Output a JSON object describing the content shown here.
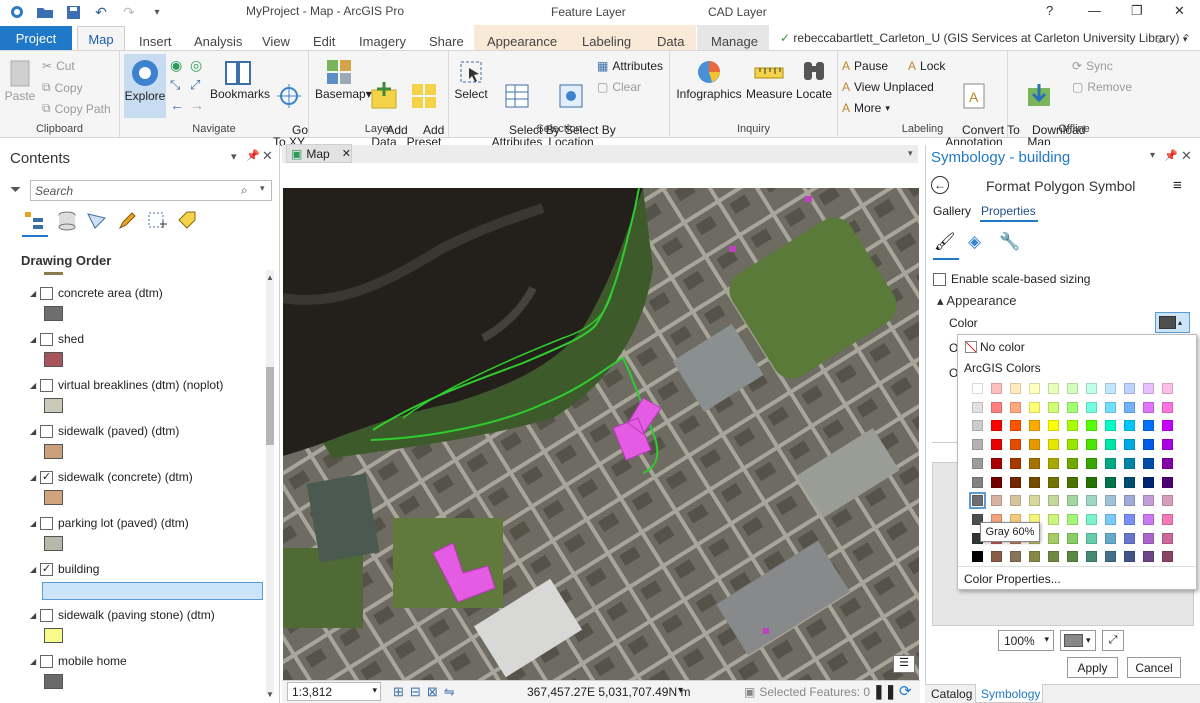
{
  "app": {
    "window_title": "MyProject - Map - ArcGIS Pro",
    "feature_layer": "Feature Layer",
    "cad_layer": "CAD Layer",
    "help": "?"
  },
  "tabs": [
    "Project",
    "Map",
    "Insert",
    "Analysis",
    "View",
    "Edit",
    "Imagery",
    "Share",
    "Appearance",
    "Labeling",
    "Data",
    "Manage"
  ],
  "user": "rebeccabartlett_Carleton_U (GIS Services at Carleton University Library)",
  "ribbon": {
    "clipboard": {
      "label": "Clipboard",
      "paste": "Paste",
      "cut": "Cut",
      "copy": "Copy",
      "copy_path": "Copy Path"
    },
    "navigate": {
      "label": "Navigate",
      "explore": "Explore",
      "bookmarks": "Bookmarks",
      "goto": "Go\nTo XY"
    },
    "layer": {
      "label": "Layer",
      "basemap": "Basemap",
      "add_data": "Add\nData",
      "add_preset": "Add\nPreset"
    },
    "selection": {
      "label": "Selection",
      "select": "Select",
      "by_attr": "Select By\nAttributes",
      "by_loc": "Select By\nLocation",
      "attributes": "Attributes",
      "clear": "Clear"
    },
    "inquiry": {
      "label": "Inquiry",
      "infographics": "Infographics",
      "measure": "Measure",
      "locate": "Locate"
    },
    "labeling": {
      "label": "Labeling",
      "pause": "Pause",
      "lock": "Lock",
      "view_unplaced": "View Unplaced",
      "more": "More",
      "convert": "Convert To\nAnnotation"
    },
    "offline": {
      "label": "Offline",
      "download": "Download\nMap",
      "sync": "Sync",
      "remove": "Remove"
    }
  },
  "contents": {
    "title": "Contents",
    "search_placeholder": "Search",
    "drawing_order": "Drawing Order",
    "layers": [
      {
        "name": "concrete area (dtm)",
        "checked": false,
        "color": "#6e6e6e"
      },
      {
        "name": "shed",
        "checked": false,
        "color": "#a8545c"
      },
      {
        "name": "virtual breaklines (dtm) (noplot)",
        "checked": false,
        "color": "#c9cbb8"
      },
      {
        "name": "sidewalk (paved) (dtm)",
        "checked": false,
        "color": "#c9a07a"
      },
      {
        "name": "sidewalk (concrete) (dtm)",
        "checked": true,
        "color": "#d2a47c"
      },
      {
        "name": "parking lot (paved) (dtm)",
        "checked": false,
        "color": "#b7b8aa"
      },
      {
        "name": "building",
        "checked": true,
        "color": "#e45be4"
      },
      {
        "name": "sidewalk (paving stone) (dtm)",
        "checked": false,
        "color": "#f8fb8a"
      },
      {
        "name": "mobile home",
        "checked": false,
        "color": "#6a6a6a"
      }
    ]
  },
  "map": {
    "tab": "Map",
    "scale": "1:3,812",
    "coords": "367,457.27E 5,031,707.49N m",
    "selected": "Selected Features: 0"
  },
  "symbology": {
    "title": "Symbology - building",
    "subtitle": "Format Polygon Symbol",
    "tab_gallery": "Gallery",
    "tab_properties": "Properties",
    "scale_sizing": "Enable scale-based sizing",
    "appearance": "Appearance",
    "color_label": "Color",
    "o1": "O",
    "o2": "O",
    "no_color": "No color",
    "arcgis_colors": "ArcGIS Colors",
    "tooltip": "Gray 60%",
    "color_props": "Color Properties...",
    "zoom": "100%",
    "apply": "Apply",
    "cancel": "Cancel",
    "bottom_catalog": "Catalog",
    "bottom_symbology": "Symbology"
  },
  "palette": {
    "columns": [
      "#ffffff",
      "#ffbebe",
      "#ffebbe",
      "#ffffbe",
      "#e9ffbe",
      "#d3ffbe",
      "#beffe8",
      "#bee8ff",
      "#bed2ff",
      "#e8beff",
      "#ffbee8"
    ],
    "rows": [
      [
        "#e1e1e1",
        "#ff7f7f",
        "#ffa77f",
        "#ffff73",
        "#d1ff73",
        "#a3ff73",
        "#73ffdf",
        "#73dfff",
        "#73b2ff",
        "#df73ff",
        "#ff73df"
      ],
      [
        "#cccccc",
        "#ff0000",
        "#ff5500",
        "#ffaa00",
        "#ffff00",
        "#aaff00",
        "#55ff00",
        "#00ffc5",
        "#00c5ff",
        "#0070ff",
        "#c500ff"
      ],
      [
        "#b2b2b2",
        "#e60000",
        "#e64c00",
        "#e69800",
        "#e6e600",
        "#98e600",
        "#4ce600",
        "#00e6a9",
        "#00a9e6",
        "#005ce6",
        "#a900e6"
      ],
      [
        "#9c9c9c",
        "#a80000",
        "#a83800",
        "#a87000",
        "#a8a800",
        "#70a800",
        "#38a800",
        "#00a884",
        "#0084a8",
        "#004da8",
        "#8400a8"
      ],
      [
        "#828282",
        "#730000",
        "#732600",
        "#734c00",
        "#737300",
        "#4c7300",
        "#267300",
        "#00734c",
        "#004c73",
        "#002673",
        "#4c0073"
      ],
      [
        "#6e6e6e",
        "#d7b09e",
        "#d7c29e",
        "#d7d79e",
        "#c2d69e",
        "#a3d69e",
        "#9ed7c2",
        "#9ec2d7",
        "#9eaad7",
        "#c29ed7",
        "#d69ebc"
      ],
      [
        "#4e4e4e",
        "#f5a27a",
        "#f5ca7a",
        "#f5f57a",
        "#cdf57a",
        "#a5f57a",
        "#7af5ca",
        "#7acaf5",
        "#7a8ef5",
        "#ca7af5",
        "#f57ab6"
      ],
      [
        "#343434",
        "#cd6666",
        "#cd8966",
        "#cdcd66",
        "#a5cd66",
        "#89cd66",
        "#66cdab",
        "#66abcd",
        "#6677cd",
        "#ab66cd",
        "#cd6699"
      ],
      [
        "#000000",
        "#895a44",
        "#89735a",
        "#898944",
        "#728944",
        "#5a8944",
        "#448970",
        "#447089",
        "#445489",
        "#704489",
        "#894465"
      ]
    ]
  }
}
